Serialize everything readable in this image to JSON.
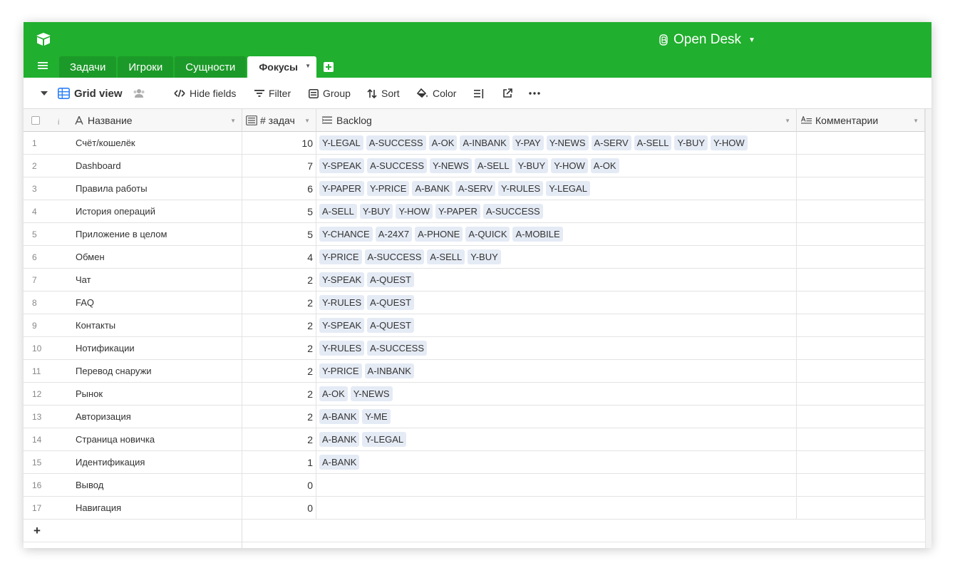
{
  "app": {
    "base_name": "Open Desk",
    "accent_color": "#20af2e"
  },
  "tabs": [
    {
      "label": "Задачи"
    },
    {
      "label": "Игроки"
    },
    {
      "label": "Сущности"
    },
    {
      "label": "Фокусы",
      "active": true
    }
  ],
  "toolbar": {
    "view_name": "Grid view",
    "hide_fields": "Hide fields",
    "filter": "Filter",
    "group": "Group",
    "sort": "Sort",
    "color": "Color"
  },
  "columns": {
    "name": "Название",
    "count": "# задач",
    "backlog": "Backlog",
    "comments": "Комментарии"
  },
  "rows": [
    {
      "num": "1",
      "name": "Счёт/кошелёк",
      "count": "10",
      "backlog": [
        "Y-LEGAL",
        "A-SUCCESS",
        "A-OK",
        "A-INBANK",
        "Y-PAY",
        "Y-NEWS",
        "A-SERV",
        "A-SELL",
        "Y-BUY",
        "Y-HOW"
      ]
    },
    {
      "num": "2",
      "name": "Dashboard",
      "count": "7",
      "backlog": [
        "Y-SPEAK",
        "A-SUCCESS",
        "Y-NEWS",
        "A-SELL",
        "Y-BUY",
        "Y-HOW",
        "A-OK"
      ]
    },
    {
      "num": "3",
      "name": "Правила работы",
      "count": "6",
      "backlog": [
        "Y-PAPER",
        "Y-PRICE",
        "A-BANK",
        "A-SERV",
        "Y-RULES",
        "Y-LEGAL"
      ]
    },
    {
      "num": "4",
      "name": "История операций",
      "count": "5",
      "backlog": [
        "A-SELL",
        "Y-BUY",
        "Y-HOW",
        "Y-PAPER",
        "A-SUCCESS"
      ]
    },
    {
      "num": "5",
      "name": "Приложение в целом",
      "count": "5",
      "backlog": [
        "Y-CHANCE",
        "A-24X7",
        "A-PHONE",
        "A-QUICK",
        "A-MOBILE"
      ]
    },
    {
      "num": "6",
      "name": "Обмен",
      "count": "4",
      "backlog": [
        "Y-PRICE",
        "A-SUCCESS",
        "A-SELL",
        "Y-BUY"
      ]
    },
    {
      "num": "7",
      "name": "Чат",
      "count": "2",
      "backlog": [
        "Y-SPEAK",
        "A-QUEST"
      ]
    },
    {
      "num": "8",
      "name": "FAQ",
      "count": "2",
      "backlog": [
        "Y-RULES",
        "A-QUEST"
      ]
    },
    {
      "num": "9",
      "name": "Контакты",
      "count": "2",
      "backlog": [
        "Y-SPEAK",
        "A-QUEST"
      ]
    },
    {
      "num": "10",
      "name": "Нотификации",
      "count": "2",
      "backlog": [
        "Y-RULES",
        "A-SUCCESS"
      ]
    },
    {
      "num": "11",
      "name": "Перевод снаружи",
      "count": "2",
      "backlog": [
        "Y-PRICE",
        "A-INBANK"
      ]
    },
    {
      "num": "12",
      "name": "Рынок",
      "count": "2",
      "backlog": [
        "A-OK",
        "Y-NEWS"
      ]
    },
    {
      "num": "13",
      "name": "Авторизация",
      "count": "2",
      "backlog": [
        "A-BANK",
        "Y-ME"
      ]
    },
    {
      "num": "14",
      "name": "Страница новичка",
      "count": "2",
      "backlog": [
        "A-BANK",
        "Y-LEGAL"
      ]
    },
    {
      "num": "15",
      "name": "Идентификация",
      "count": "1",
      "backlog": [
        "A-BANK"
      ]
    },
    {
      "num": "16",
      "name": "Вывод",
      "count": "0",
      "backlog": []
    },
    {
      "num": "17",
      "name": "Навигация",
      "count": "0",
      "backlog": []
    }
  ],
  "add_row_label": "+"
}
